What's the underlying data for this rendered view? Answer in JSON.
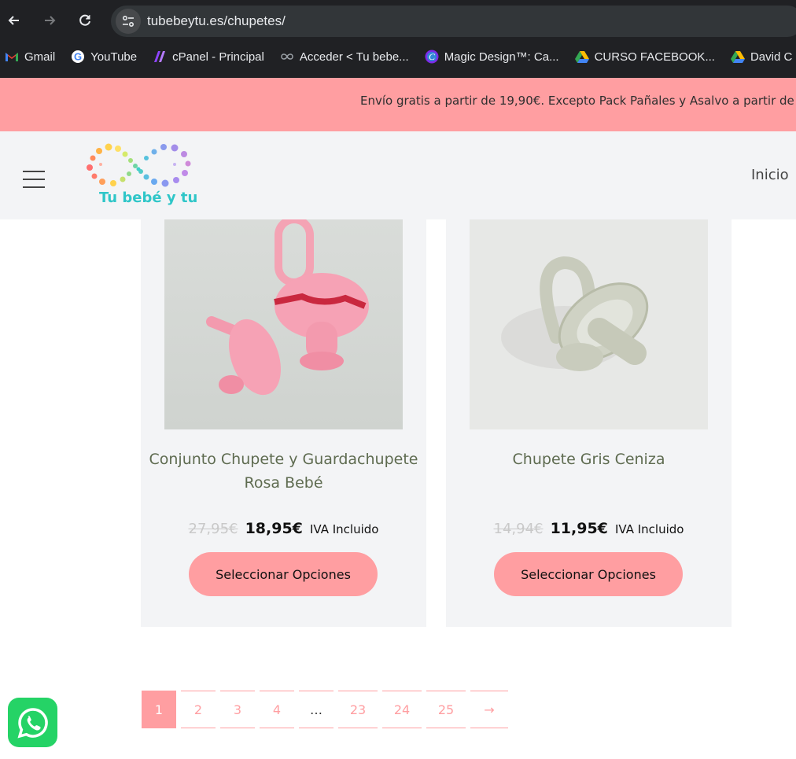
{
  "browser": {
    "url": "tubebeytu.es/chupetes/",
    "bookmarks": [
      {
        "label": "Gmail",
        "icon": "gmail-icon"
      },
      {
        "label": "YouTube",
        "icon": "google-icon"
      },
      {
        "label": "cPanel - Principal",
        "icon": "cpanel-icon"
      },
      {
        "label": "Acceder < Tu bebe...",
        "icon": "infinity-icon"
      },
      {
        "label": "Magic Design™: Ca...",
        "icon": "canva-icon"
      },
      {
        "label": "CURSO FACEBOOK...",
        "icon": "drive-icon"
      },
      {
        "label": "David C",
        "icon": "drive-icon"
      }
    ]
  },
  "announcement": "Envío gratis a partir de 19,90€. Excepto Pack Pañales y Asalvo a partir de",
  "header": {
    "brand": "Tu bebé y tu",
    "menu_item": "Inicio"
  },
  "products": [
    {
      "title": "Conjunto Chupete y Guardachupete Rosa Bebé",
      "old_price": "27,95€",
      "price": "18,95€",
      "tax_note": "IVA Incluido",
      "button": "Seleccionar Opciones"
    },
    {
      "title": "Chupete Gris Ceniza",
      "old_price": "14,94€",
      "price": "11,95€",
      "tax_note": "IVA Incluido",
      "button": "Seleccionar Opciones"
    }
  ],
  "pagination": [
    "1",
    "2",
    "3",
    "4",
    "…",
    "23",
    "24",
    "25",
    "→"
  ],
  "colors": {
    "accent": "#ff9ea1",
    "header_bg": "#f3f4f6",
    "title_green": "#5e6b50",
    "whatsapp": "#25d366"
  }
}
